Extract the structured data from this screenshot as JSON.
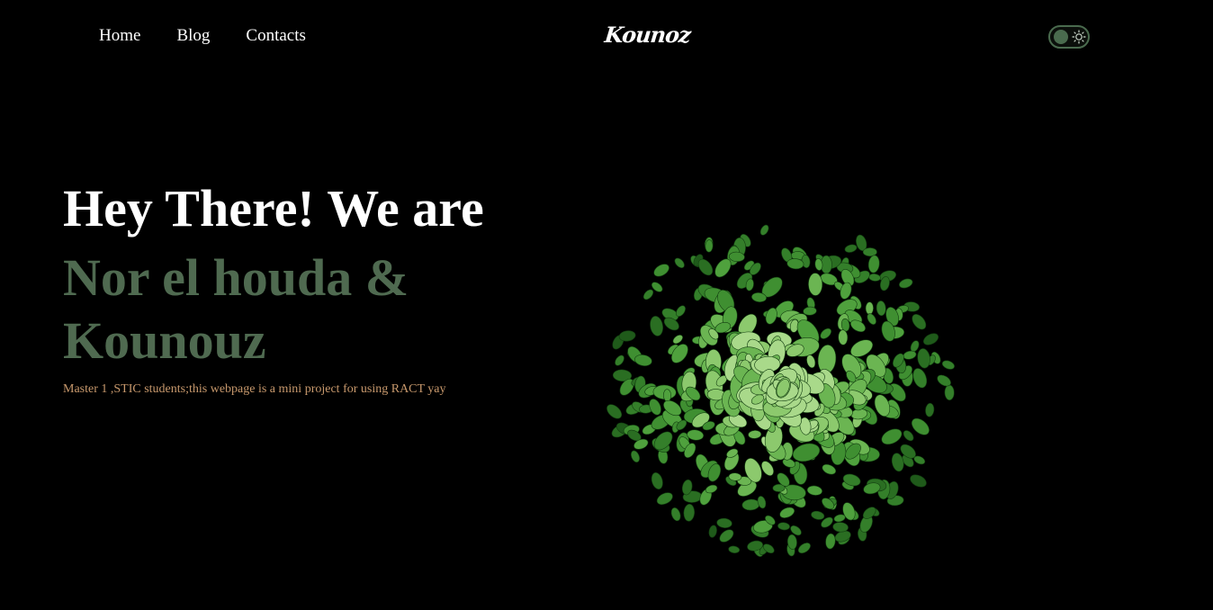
{
  "nav": {
    "items": [
      {
        "label": "Home"
      },
      {
        "label": "Blog"
      },
      {
        "label": "Contacts"
      }
    ]
  },
  "brand": {
    "logo_text": "Kounoz"
  },
  "theme_toggle": {
    "state": "dark",
    "icon": "sun-icon"
  },
  "hero": {
    "title": "Hey There! We are",
    "names": "Nor el houda & Kounouz",
    "subtitle": "Master 1 ,STIC students;this webpage is a mini project for using RACT yay"
  },
  "colors": {
    "background": "#000000",
    "accent_green": "#4f6a50",
    "subtitle": "#c7986c",
    "text": "#ffffff"
  }
}
